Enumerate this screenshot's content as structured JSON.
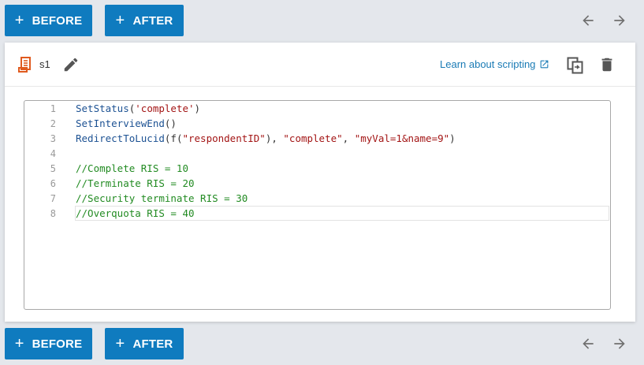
{
  "toolbar": {
    "before_label": "BEFORE",
    "after_label": "AFTER",
    "plus": "+"
  },
  "header": {
    "script_name": "s1",
    "learn_link": "Learn about scripting"
  },
  "editor": {
    "line_numbers": [
      "1",
      "2",
      "3",
      "4",
      "5",
      "6",
      "7",
      "8"
    ],
    "lines": [
      {
        "fn": "SetStatus",
        "open": "(",
        "s1": "'complete'",
        "close": ")"
      },
      {
        "fn": "SetInterviewEnd",
        "open": "()"
      },
      {
        "fn": "RedirectToLucid",
        "open": "(f(",
        "s1": "\"respondentID\"",
        "mid1": "), ",
        "s2": "\"complete\"",
        "mid2": ", ",
        "s3": "\"myVal=1&name=9\"",
        "close": ")"
      },
      {},
      {
        "comment": "//Complete RIS = 10"
      },
      {
        "comment": "//Terminate RIS = 20"
      },
      {
        "comment": "//Security terminate RIS = 30"
      },
      {
        "comment": "//Overquota RIS = 40"
      }
    ]
  },
  "colors": {
    "accent": "#0f7bbf",
    "link": "#1a7bb5",
    "script_icon": "#e05a1e",
    "comment": "#228b22",
    "string": "#a31515"
  },
  "icons": {
    "script": "script-icon",
    "edit": "pencil-icon",
    "external": "external-link-icon",
    "copy": "copy-icon",
    "delete": "trash-icon",
    "left": "arrow-left-icon",
    "right": "arrow-right-icon"
  }
}
